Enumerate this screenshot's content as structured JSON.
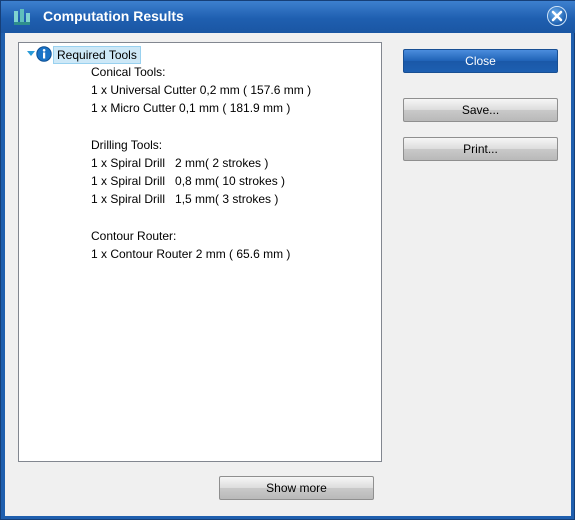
{
  "window": {
    "title": "Computation Results"
  },
  "tree": {
    "root_label": "Required Tools",
    "lines": [
      "Conical Tools:",
      "1 x Universal Cutter 0,2 mm ( 157.6 mm )",
      "1 x Micro Cutter 0,1 mm ( 181.9 mm )",
      "",
      "Drilling Tools:",
      "1 x Spiral Drill   2 mm( 2 strokes )",
      "1 x Spiral Drill   0,8 mm( 10 strokes )",
      "1 x Spiral Drill   1,5 mm( 3 strokes )",
      "",
      "Contour Router:",
      "1 x Contour Router 2 mm ( 65.6 mm )"
    ]
  },
  "buttons": {
    "close": "Close",
    "save": "Save...",
    "print": "Print...",
    "show_more": "Show more"
  },
  "colors": {
    "titlebar": "#1f5fae",
    "primary_button": "#1f62b6",
    "selection": "#cde8f7",
    "background_outside": "#c62020"
  },
  "icons": {
    "app": "app-icon",
    "info": "info-icon",
    "close": "close-icon",
    "expander": "expander-triangle"
  }
}
